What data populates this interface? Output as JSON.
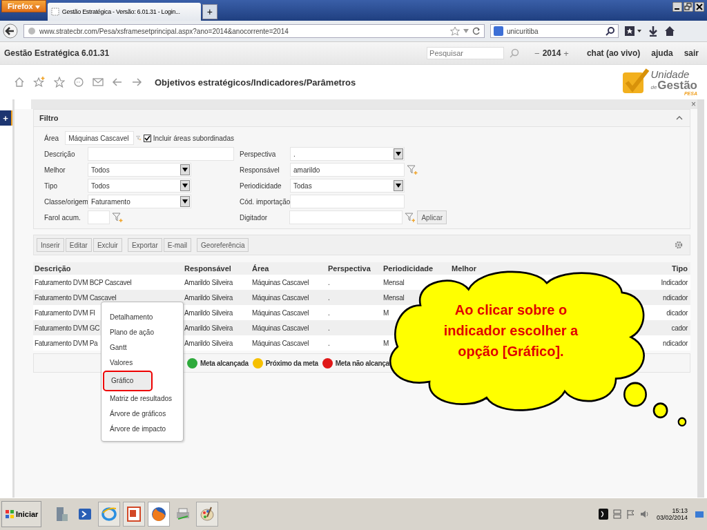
{
  "browser": {
    "menu_button": "Firefox",
    "tab_title": "Gestão Estratégica - Versão: 6.01.31 - Login...",
    "new_tab": "+",
    "url": "www.stratecbr.com/Pesa/xsframesetprincipal.aspx?ano=2014&anocorrente=2014",
    "search_value": "unicuritiba"
  },
  "app_bar": {
    "title": "Gestão Estratégica 6.01.31",
    "search_placeholder": "Pesquisar",
    "year_prev": "−",
    "year": "2014",
    "year_next": "+",
    "links": [
      "chat (ao vivo)",
      "ajuda",
      "sair"
    ]
  },
  "toolbar": {
    "breadcrumb": "Objetivos estratégicos/Indicadores/Parâmetros",
    "logo": {
      "line1": "Unidade",
      "de": "de",
      "line2": "Gestão",
      "sub": "PESA"
    }
  },
  "side_button": "+",
  "close": "×",
  "filter": {
    "title": "Filtro",
    "expanded": true,
    "left": [
      {
        "label": "Área",
        "value": "Máquinas Cascavel",
        "kind": "lookup"
      },
      {
        "label": "Descrição",
        "kind": "text"
      },
      {
        "label": "Melhor",
        "value": "Todos",
        "kind": "select"
      },
      {
        "label": "Tipo",
        "value": "Todos",
        "kind": "select"
      },
      {
        "label": "Classe/origem",
        "value": "Faturamento",
        "kind": "select"
      },
      {
        "label": "Farol acum.",
        "kind": "small-lookup"
      }
    ],
    "include_sub": {
      "label": "Incluir áreas subordinadas",
      "checked": true
    },
    "right": [
      {
        "label": "Perspectiva",
        "value": ".",
        "kind": "select"
      },
      {
        "label": "Responsável",
        "value": "amarildo",
        "kind": "lookup"
      },
      {
        "label": "Periodicidade",
        "value": "Todas",
        "kind": "select"
      },
      {
        "label": "Cód. importação",
        "kind": "text"
      },
      {
        "label": "Digitador",
        "kind": "lookup"
      }
    ],
    "apply": "Aplicar"
  },
  "actions": [
    [
      "Inserir",
      "Editar",
      "Excluir"
    ],
    [
      "Exportar",
      "E-mail"
    ],
    [
      "Georeferência"
    ]
  ],
  "table": {
    "columns": [
      "Descrição",
      "Responsável",
      "Área",
      "Perspectiva",
      "Periodicidade",
      "Melhor",
      "Tipo"
    ],
    "rows": [
      {
        "descricao": "Faturamento DVM BCP Cascavel",
        "responsavel": "Amarildo Silveira",
        "area": "Máquinas Cascavel",
        "perspectiva": ".",
        "periodicidade": "Mensal",
        "tipo": "Indicador"
      },
      {
        "descricao": "Faturamento DVM Cascavel",
        "responsavel": "Amarildo Silveira",
        "area": "Máquinas Cascavel",
        "perspectiva": ".",
        "periodicidade": "Mensal",
        "tipo": "ndicador"
      },
      {
        "descricao": "Faturamento DVM Fl",
        "responsavel": "Amarildo Silveira",
        "area": "Máquinas Cascavel",
        "perspectiva": ".",
        "periodicidade": "M",
        "tipo": "dicador"
      },
      {
        "descricao": "Faturamento DVM GC",
        "responsavel": "Amarildo Silveira",
        "area": "Máquinas Cascavel",
        "perspectiva": ".",
        "tipo": "cador"
      },
      {
        "descricao": "Faturamento DVM Pa",
        "responsavel": "Amarildo Silveira",
        "area": "Máquinas Cascavel",
        "perspectiva": ".",
        "periodicidade": "M",
        "tipo": "ndicador"
      }
    ]
  },
  "legend": [
    {
      "label": "Meta alcançada",
      "color": "#2eaa3c"
    },
    {
      "label": "Próximo da meta",
      "color": "#f6c000"
    },
    {
      "label": "Meta não alcança",
      "color": "#e01818"
    }
  ],
  "context_menu": [
    {
      "label": "Detalhamento",
      "selected": false
    },
    {
      "label": "Plano de ação",
      "selected": false
    },
    {
      "label": "Gantt",
      "selected": false
    },
    {
      "label": "Valores",
      "selected": false
    },
    {
      "label": "Gráfico",
      "selected": true
    },
    {
      "label": "Matriz de resultados",
      "selected": false
    },
    {
      "label": "Árvore de gráficos",
      "selected": false
    },
    {
      "label": "Árvore de impacto",
      "selected": false
    }
  ],
  "callout": "Ao clicar sobre o indicador escolher a opção [Gráfico].",
  "taskbar": {
    "start": "Iniciar",
    "time": "15:13",
    "date": "03/02/2014"
  }
}
